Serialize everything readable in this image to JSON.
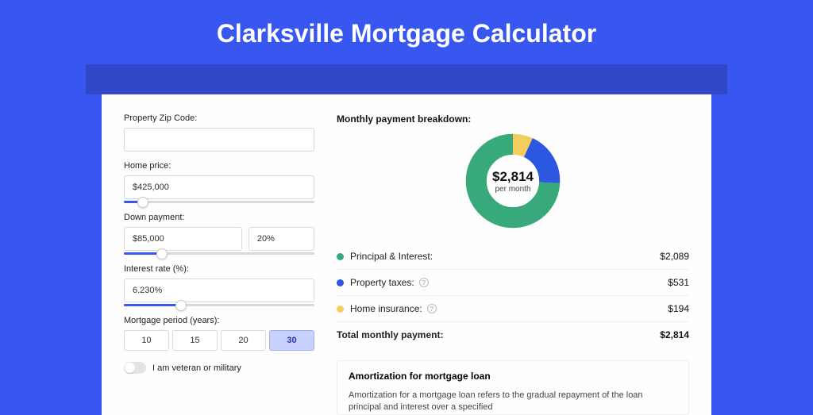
{
  "page_title": "Clarksville Mortgage Calculator",
  "form": {
    "zip_label": "Property Zip Code:",
    "zip_value": "",
    "home_price_label": "Home price:",
    "home_price_value": "$425,000",
    "home_price_slider_pct": 10,
    "down_payment_label": "Down payment:",
    "down_payment_value": "$85,000",
    "down_payment_pct_value": "20%",
    "down_payment_slider_pct": 20,
    "interest_label": "Interest rate (%):",
    "interest_value": "6.230%",
    "interest_slider_pct": 30,
    "period_label": "Mortgage period (years):",
    "periods": [
      "10",
      "15",
      "20",
      "30"
    ],
    "period_selected": "30",
    "veteran_label": "I am veteran or military",
    "veteran_on": false
  },
  "breakdown": {
    "title": "Monthly payment breakdown:",
    "center_amount": "$2,814",
    "center_sub": "per month",
    "items": [
      {
        "label": "Principal & Interest:",
        "value": "$2,089",
        "color": "#38a97a",
        "info": false,
        "raw": 2089
      },
      {
        "label": "Property taxes:",
        "value": "$531",
        "color": "#2c57e0",
        "info": true,
        "raw": 531
      },
      {
        "label": "Home insurance:",
        "value": "$194",
        "color": "#f3cd5d",
        "info": true,
        "raw": 194
      }
    ],
    "total_label": "Total monthly payment:",
    "total_value": "$2,814"
  },
  "chart_data": {
    "type": "pie",
    "title": "Monthly payment breakdown",
    "series": [
      {
        "name": "Principal & Interest",
        "value": 2089,
        "color": "#38a97a"
      },
      {
        "name": "Property taxes",
        "value": 531,
        "color": "#2c57e0"
      },
      {
        "name": "Home insurance",
        "value": 194,
        "color": "#f3cd5d"
      }
    ],
    "total": 2814,
    "center_label": "$2,814 per month"
  },
  "amortization": {
    "title": "Amortization for mortgage loan",
    "text": "Amortization for a mortgage loan refers to the gradual repayment of the loan principal and interest over a specified"
  }
}
